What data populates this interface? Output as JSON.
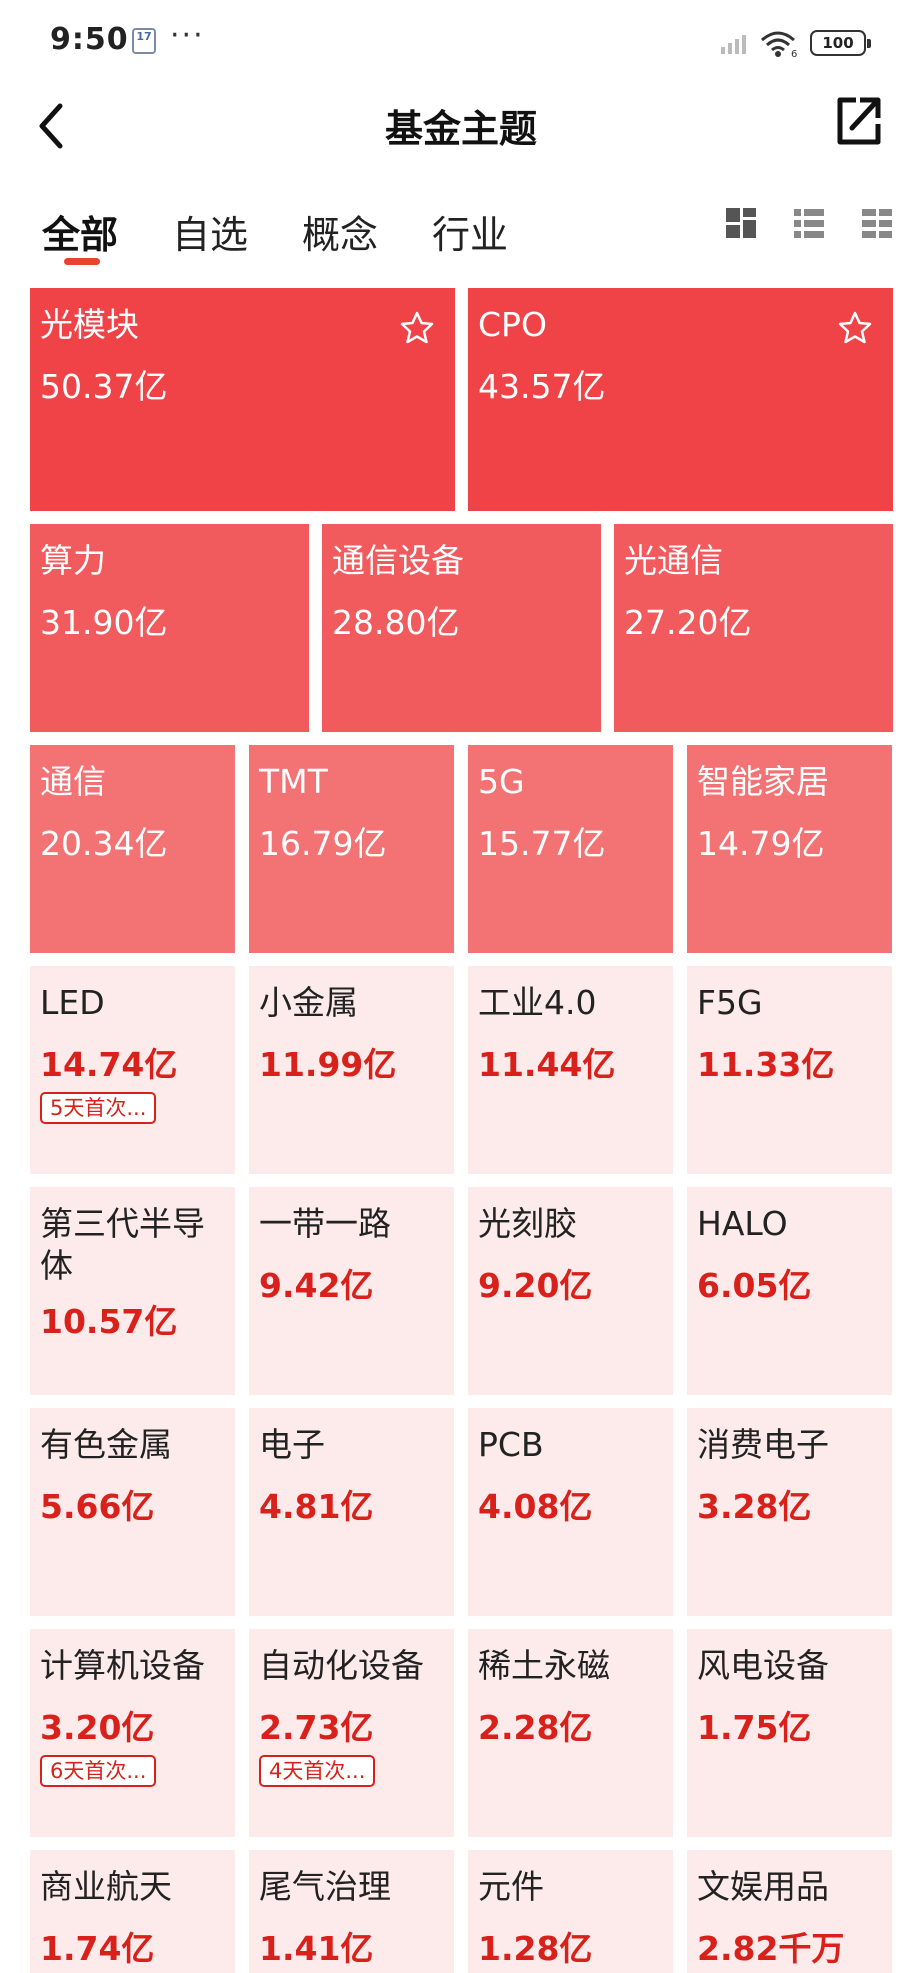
{
  "status": {
    "time": "9:50",
    "cal_day": "17",
    "more": "···",
    "signal_sub": "6",
    "battery": "100"
  },
  "header": {
    "title": "基金主题"
  },
  "tabs": [
    "全部",
    "自选",
    "概念",
    "行业"
  ],
  "colors": {
    "accent": "#e8432f",
    "tile_top": "#f04347",
    "tile_mid": "#f25b5e",
    "tile_third": "#f37375",
    "tile_weak": "#fdebeb",
    "value_red": "#d9211b"
  },
  "themes": [
    {
      "name": "光模块",
      "value": "50.37亿",
      "starred": false
    },
    {
      "name": "CPO",
      "value": "43.57亿",
      "starred": false
    },
    {
      "name": "算力",
      "value": "31.90亿"
    },
    {
      "name": "通信设备",
      "value": "28.80亿"
    },
    {
      "name": "光通信",
      "value": "27.20亿"
    },
    {
      "name": "通信",
      "value": "20.34亿"
    },
    {
      "name": "TMT",
      "value": "16.79亿"
    },
    {
      "name": "5G",
      "value": "15.77亿"
    },
    {
      "name": "智能家居",
      "value": "14.79亿"
    },
    {
      "name": "LED",
      "value": "14.74亿",
      "badge": "5天首次..."
    },
    {
      "name": "小金属",
      "value": "11.99亿"
    },
    {
      "name": "工业4.0",
      "value": "11.44亿"
    },
    {
      "name": "F5G",
      "value": "11.33亿"
    },
    {
      "name": "第三代半导体",
      "value": "10.57亿"
    },
    {
      "name": "一带一路",
      "value": "9.42亿"
    },
    {
      "name": "光刻胶",
      "value": "9.20亿"
    },
    {
      "name": "HALO",
      "value": "6.05亿"
    },
    {
      "name": "有色金属",
      "value": "5.66亿"
    },
    {
      "name": "电子",
      "value": "4.81亿"
    },
    {
      "name": "PCB",
      "value": "4.08亿"
    },
    {
      "name": "消费电子",
      "value": "3.28亿"
    },
    {
      "name": "计算机设备",
      "value": "3.20亿",
      "badge": "6天首次..."
    },
    {
      "name": "自动化设备",
      "value": "2.73亿",
      "badge": "4天首次..."
    },
    {
      "name": "稀土永磁",
      "value": "2.28亿"
    },
    {
      "name": "风电设备",
      "value": "1.75亿"
    },
    {
      "name": "商业航天",
      "value": "1.74亿"
    },
    {
      "name": "尾气治理",
      "value": "1.41亿"
    },
    {
      "name": "元件",
      "value": "1.28亿"
    },
    {
      "name": "文娱用品",
      "value": "2.82千万"
    }
  ]
}
